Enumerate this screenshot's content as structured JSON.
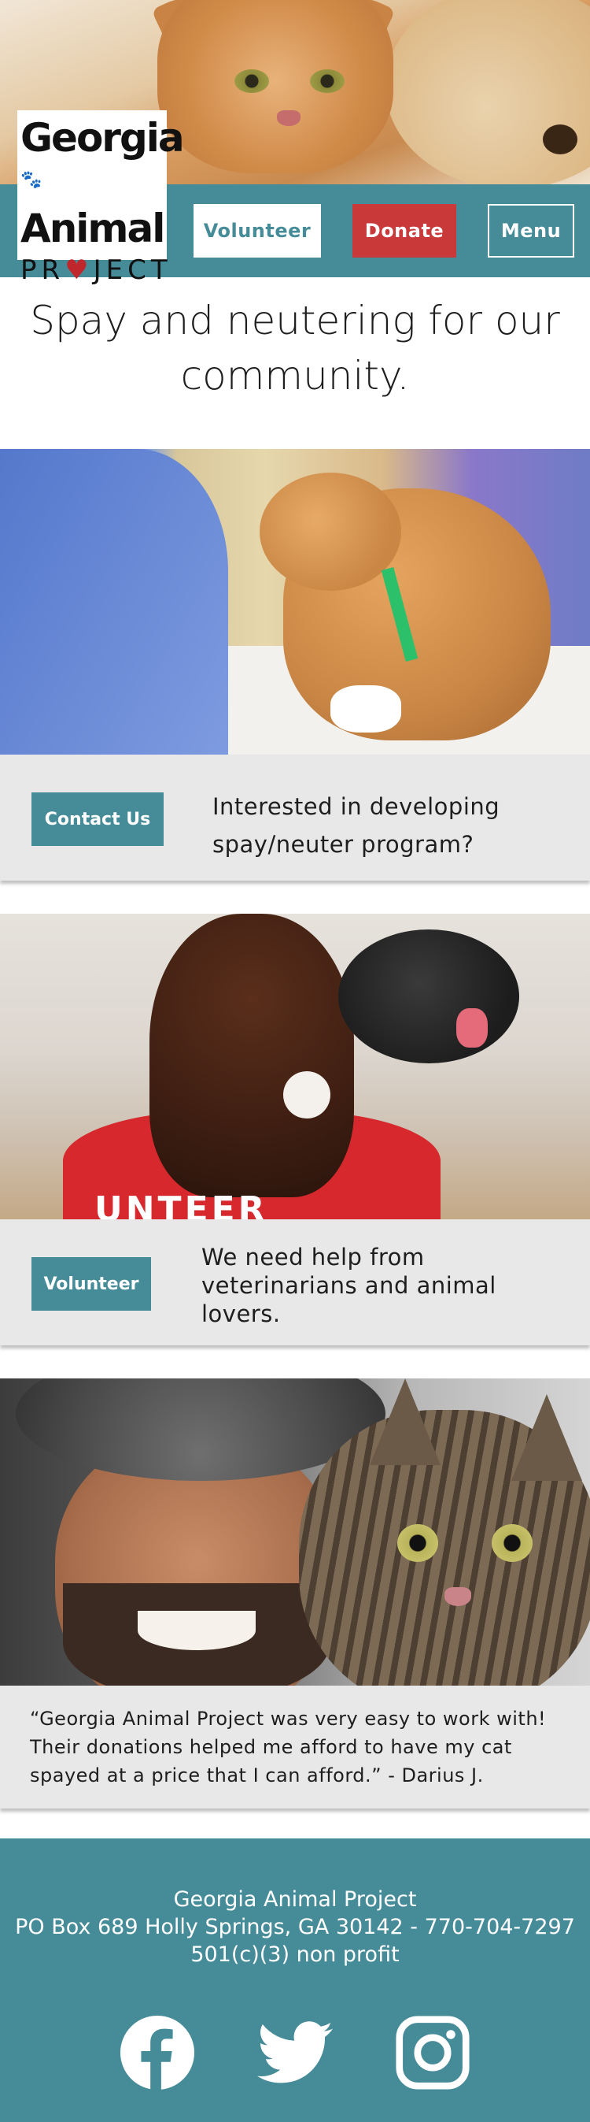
{
  "header": {
    "logo_line1": "Georgia",
    "logo_line2": "Animal",
    "logo_line3_before": "PR",
    "logo_line3_after": "JECT",
    "nav": {
      "volunteer_label": "Volunteer",
      "donate_label": "Donate",
      "menu_label": "Menu"
    },
    "colors": {
      "teal": "#468c98",
      "donate_red": "#c9393a"
    }
  },
  "tagline": "Spay and neutering for our community.",
  "sections": [
    {
      "button_label": "Contact Us",
      "text": "Interested in developing spay/neuter program?"
    },
    {
      "button_label": "Volunteer",
      "text": "We need help from veterinarians and animal lovers.",
      "shirt_text": "UNTEER"
    },
    {
      "quote": "“Georgia Animal Project was very easy to work with! Their donations helped me afford to have my cat spayed at a price that I can afford.” - Darius J."
    }
  ],
  "footer": {
    "org_name": "Georgia Animal Project",
    "address": "PO Box 689 Holly Springs, GA 30142 - 770-704-7297",
    "status": "501(c)(3) non profit",
    "social_icons": [
      "facebook-icon",
      "twitter-icon",
      "instagram-icon"
    ]
  }
}
